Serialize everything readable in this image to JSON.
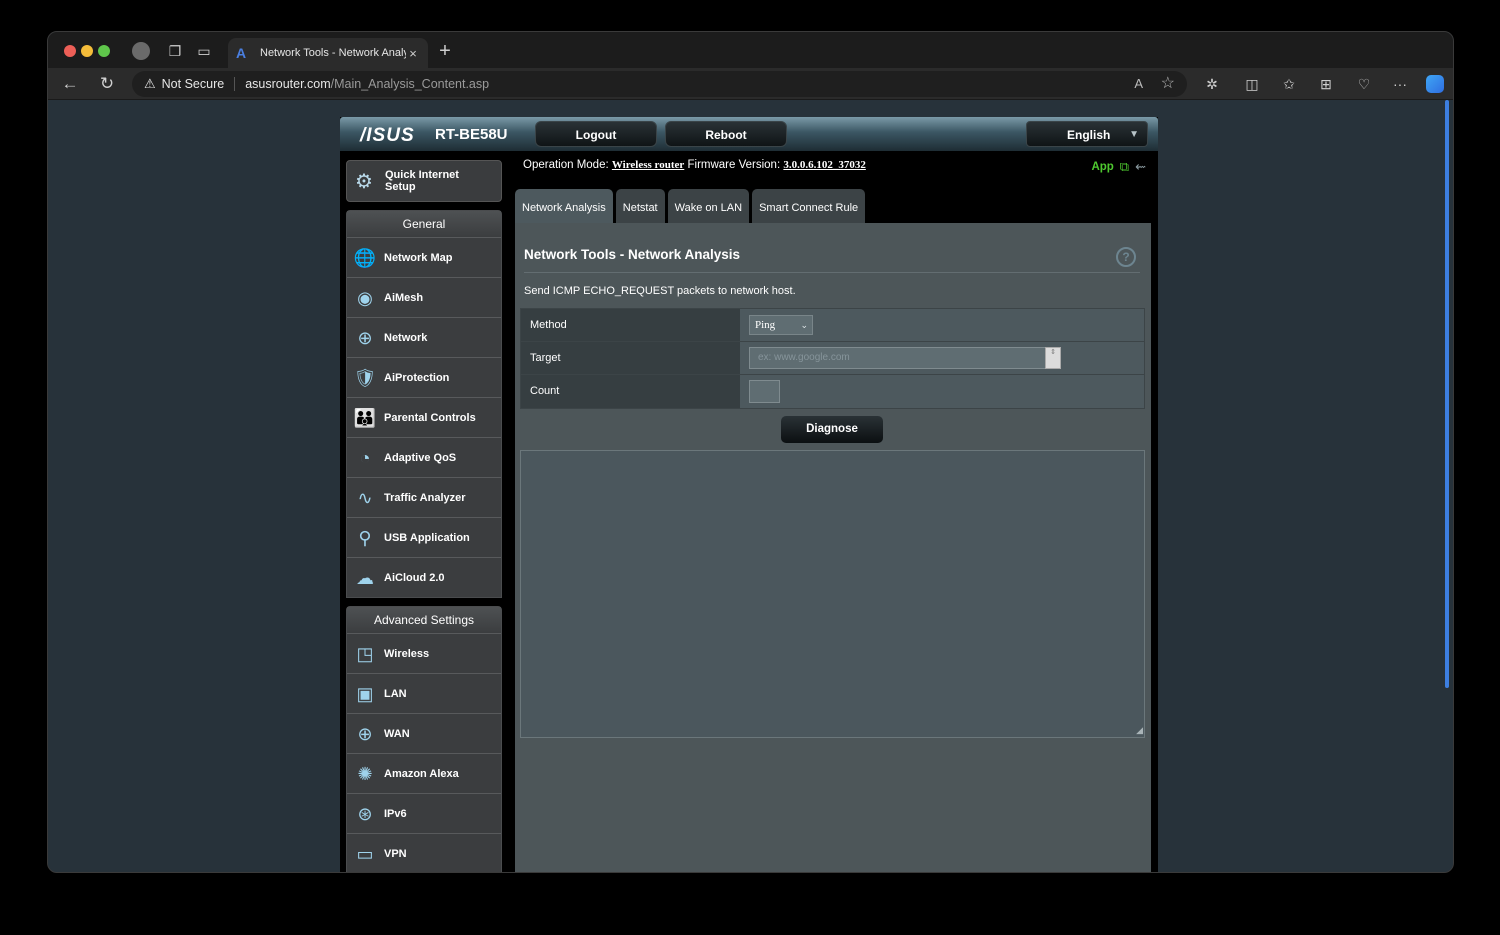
{
  "browser": {
    "tab_title": "Network Tools - Network Analy",
    "security_label": "Not Secure",
    "url_host": "asusrouter.com",
    "url_path": "/Main_Analysis_Content.asp",
    "icons": {
      "back": "←",
      "reload": "↻",
      "warning": "⚠",
      "read_aloud": "A",
      "favorite": "☆",
      "extensions": "✲",
      "split": "◫",
      "favorites": "✩",
      "collections": "⊞",
      "health": "♡",
      "more": "···",
      "new_tab": "+",
      "close_tab": "×",
      "tab_favicon": "A",
      "workspaces": "❐",
      "tab_actions": "▭"
    }
  },
  "router": {
    "brand": "/ISUS",
    "model": "RT-BE58U",
    "logout_label": "Logout",
    "reboot_label": "Reboot",
    "language": "English",
    "language_caret": "▼",
    "operation_mode_label": "Operation Mode:",
    "operation_mode_value": "Wireless router",
    "firmware_label": "Firmware Version:",
    "firmware_value": "3.0.0.6.102_37032",
    "app_label": "App",
    "app_icon": "⧉",
    "usb_icon": "⇜"
  },
  "sidebar": {
    "quick_setup": {
      "label": "Quick Internet Setup",
      "icon": "⚙"
    },
    "general": {
      "header": "General",
      "items": [
        {
          "label": "Network Map",
          "icon": "🌐"
        },
        {
          "label": "AiMesh",
          "icon": "◉"
        },
        {
          "label": "Network",
          "icon": "⊕"
        },
        {
          "label": "AiProtection",
          "icon": "🛡"
        },
        {
          "label": "Parental Controls",
          "icon": "👪"
        },
        {
          "label": "Adaptive QoS",
          "icon": "◔"
        },
        {
          "label": "Traffic Analyzer",
          "icon": "∿"
        },
        {
          "label": "USB Application",
          "icon": "⚲"
        },
        {
          "label": "AiCloud 2.0",
          "icon": "☁"
        }
      ]
    },
    "advanced": {
      "header": "Advanced Settings",
      "items": [
        {
          "label": "Wireless",
          "icon": "◳"
        },
        {
          "label": "LAN",
          "icon": "▣"
        },
        {
          "label": "WAN",
          "icon": "⊕"
        },
        {
          "label": "Amazon Alexa",
          "icon": "✺"
        },
        {
          "label": "IPv6",
          "icon": "⊛"
        },
        {
          "label": "VPN",
          "icon": "▭"
        }
      ]
    }
  },
  "content": {
    "tabs": [
      {
        "label": "Network Analysis",
        "active": true
      },
      {
        "label": "Netstat",
        "active": false
      },
      {
        "label": "Wake on LAN",
        "active": false
      },
      {
        "label": "Smart Connect Rule",
        "active": false
      }
    ],
    "title": "Network Tools - Network Analysis",
    "help_icon": "?",
    "description": "Send ICMP ECHO_REQUEST packets to network host.",
    "form": {
      "method_label": "Method",
      "method_value": "Ping",
      "method_caret": "⌄",
      "target_label": "Target",
      "target_placeholder": "ex: www.google.com",
      "target_value": "",
      "spinner": "⇕",
      "count_label": "Count",
      "count_value": ""
    },
    "diagnose_label": "Diagnose",
    "output_value": "",
    "resize_grip": "◢"
  }
}
